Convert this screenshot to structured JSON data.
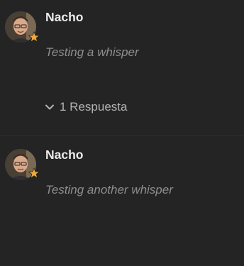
{
  "posts": [
    {
      "author": "Nacho",
      "text": "Testing a whisper",
      "avatar_icon": "user-avatar",
      "badge_icon": "star-icon",
      "replies": {
        "label": "1 Respuesta",
        "icon": "chevron-down-icon"
      }
    },
    {
      "author": "Nacho",
      "text": "Testing another whisper",
      "avatar_icon": "user-avatar",
      "badge_icon": "star-icon"
    }
  ],
  "colors": {
    "background": "#242424",
    "author": "#ececec",
    "whisper_text": "#8e8e8e",
    "replies_text": "#b3b3b3",
    "star": "#f0a93b"
  }
}
